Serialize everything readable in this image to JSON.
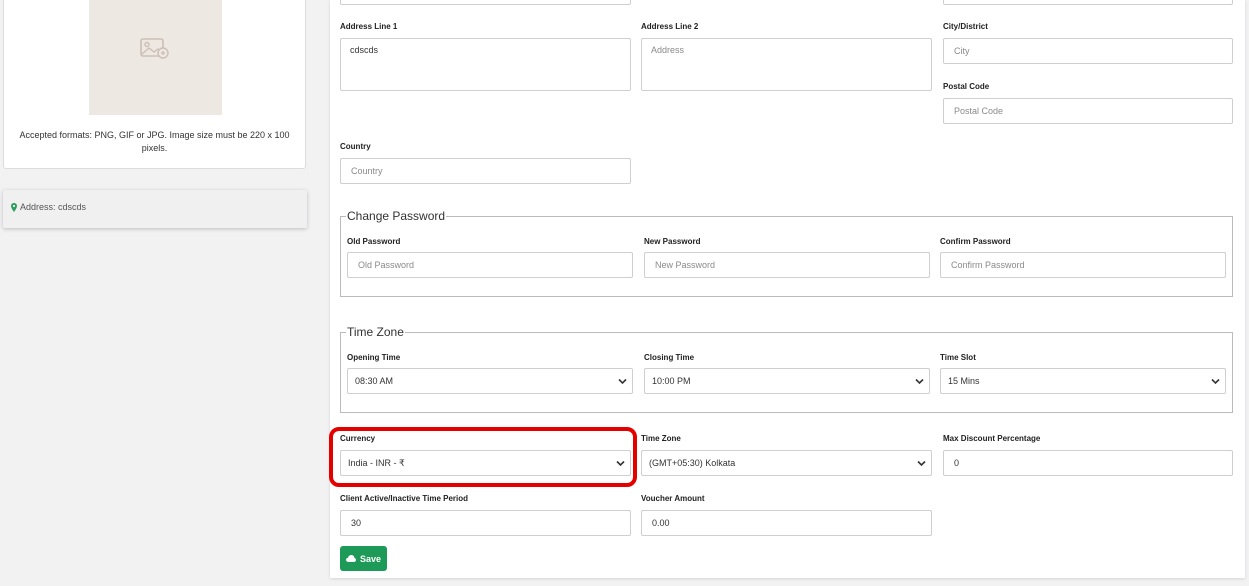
{
  "logo": {
    "note": "Accepted formats: PNG, GIF or JPG. Image size must be 220 x 100 pixels.",
    "icon": "image-placeholder-icon"
  },
  "address_card": {
    "text": "Address: cdscds",
    "icon": "map-marker-icon"
  },
  "address": {
    "line1_label": "Address Line 1",
    "line1_value": "cdscds",
    "line2_label": "Address Line 2",
    "line2_placeholder": "Address",
    "city_label": "City/District",
    "city_placeholder": "City",
    "postal_label": "Postal Code",
    "postal_placeholder": "Postal Code",
    "country_label": "Country",
    "country_placeholder": "Country"
  },
  "change_password": {
    "legend": "Change Password",
    "old_label": "Old Password",
    "old_placeholder": "Old Password",
    "new_label": "New Password",
    "new_placeholder": "New Password",
    "confirm_label": "Confirm Password",
    "confirm_placeholder": "Confirm Password"
  },
  "time_zone_section": {
    "legend": "Time Zone",
    "opening_label": "Opening Time",
    "opening_value": "08:30 AM",
    "closing_label": "Closing Time",
    "closing_value": "10:00 PM",
    "slot_label": "Time Slot",
    "slot_value": "15 Mins"
  },
  "settings": {
    "currency_label": "Currency",
    "currency_value": "India - INR - ₹",
    "timezone_label": "Time Zone",
    "timezone_value": "(GMT+05:30) Kolkata",
    "max_discount_label": "Max Discount Percentage",
    "max_discount_value": "0",
    "client_period_label": "Client Active/Inactive Time Period",
    "client_period_value": "30",
    "voucher_label": "Voucher Amount",
    "voucher_value": "0.00"
  },
  "save_button": {
    "label": "Save",
    "icon": "cloud-upload-icon"
  },
  "colors": {
    "accent_green": "#1e9a58",
    "highlight_red": "#e50000"
  }
}
